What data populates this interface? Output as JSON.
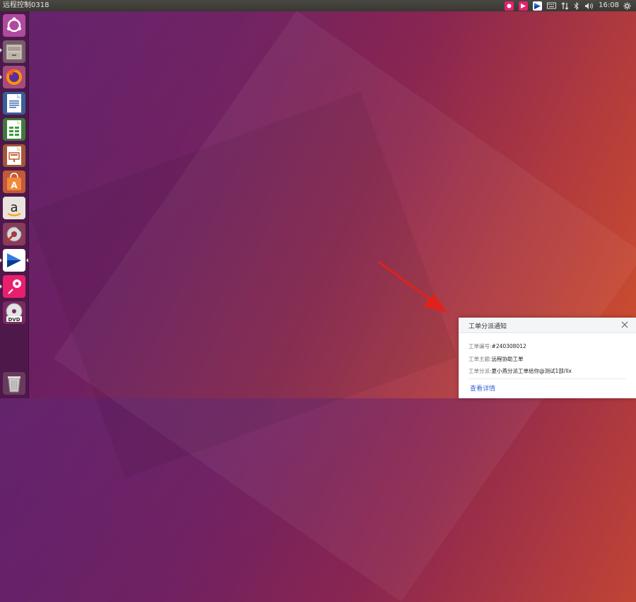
{
  "top_panel": {
    "app_title": "远程控制0318",
    "clock": "16:08"
  },
  "launcher": {
    "items": [
      {
        "name": "ubuntu-dash",
        "icon": "ubuntu-logo-icon"
      },
      {
        "name": "files",
        "icon": "file-cabinet-icon"
      },
      {
        "name": "firefox",
        "icon": "firefox-icon"
      },
      {
        "name": "writer",
        "icon": "libreoffice-writer-icon"
      },
      {
        "name": "calc",
        "icon": "libreoffice-calc-icon"
      },
      {
        "name": "impress",
        "icon": "libreoffice-impress-icon"
      },
      {
        "name": "software-center",
        "icon": "shopping-bag-icon"
      },
      {
        "name": "amazon",
        "icon": "amazon-icon"
      },
      {
        "name": "settings",
        "icon": "wrench-gear-icon"
      },
      {
        "name": "remote-app",
        "icon": "remote-control-icon"
      },
      {
        "name": "pink-app",
        "icon": "pink-app-icon"
      },
      {
        "name": "dvd",
        "icon": "dvd-icon"
      },
      {
        "name": "trash",
        "icon": "trash-icon"
      }
    ]
  },
  "notification": {
    "title": "工单分派通知",
    "rows": [
      {
        "label": "工单编号:",
        "value": "#240308012"
      },
      {
        "label": "工单主题:",
        "value": "远程协助工单"
      },
      {
        "label": "工单分派:",
        "value": "夏小燕分派工单给你@测试1部/llx"
      }
    ],
    "link": "查看详情"
  },
  "colors": {
    "accent_link": "#3a66d6",
    "tray_pink": "#e8206c",
    "arrow_red": "#e0221c"
  }
}
